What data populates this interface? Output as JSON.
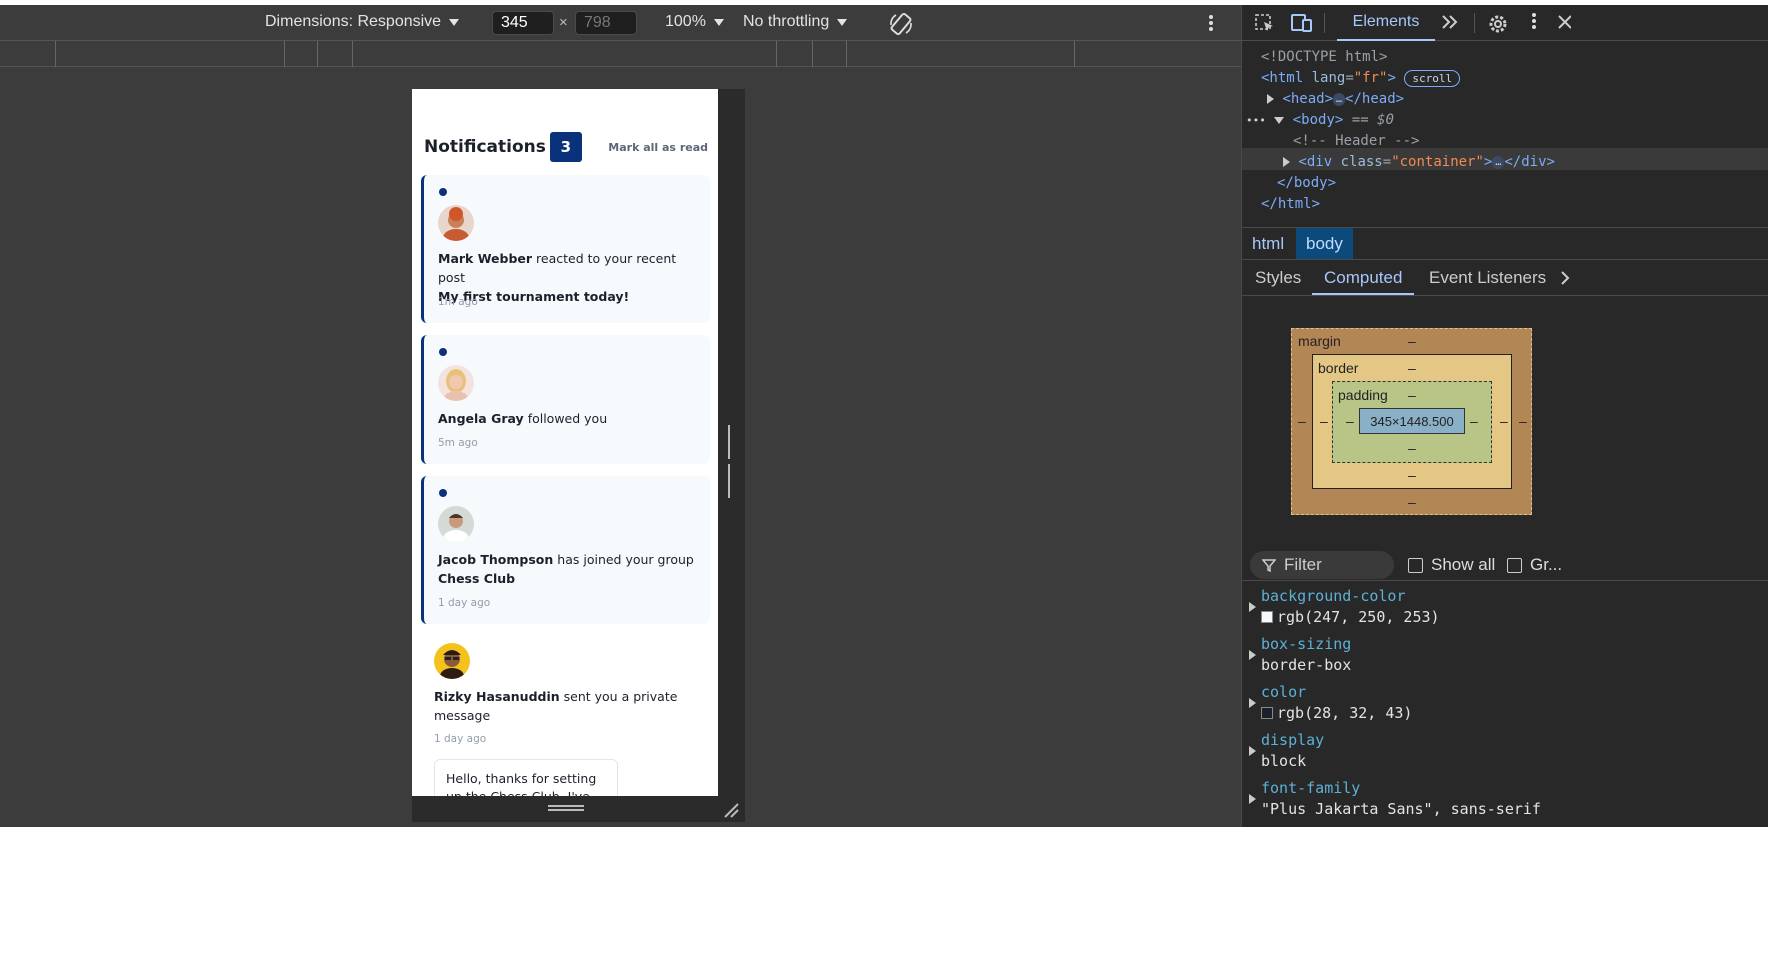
{
  "toolbar": {
    "dimensions_label": "Dimensions: Responsive",
    "width_value": "345",
    "times": "×",
    "height_placeholder": "798",
    "zoom": "100%",
    "throttling": "No throttling"
  },
  "app": {
    "title": "Notifications",
    "count": "3",
    "mark_all": "Mark all as read",
    "notifications": [
      {
        "user": "Mark Webber",
        "action": "reacted to your recent post",
        "target": "My first tournament today!",
        "time": "1m ago"
      },
      {
        "user": "Angela Gray",
        "action": "followed you",
        "target": "",
        "time": "5m ago"
      },
      {
        "user": "Jacob Thompson",
        "action": "has joined your group",
        "target": "Chess Club",
        "time": "1 day ago"
      },
      {
        "user": "Rizky Hasanuddin",
        "action": "sent you a private message",
        "target": "",
        "time": "1 day ago",
        "message": "Hello, thanks for setting up the Chess Club. I've been a"
      }
    ]
  },
  "devtools": {
    "tab_elements": "Elements",
    "dom": {
      "doctype": "<!DOCTYPE html>",
      "html_open": "<html",
      "lang_attr": "lang",
      "lang_value": "\"fr\"",
      "html_close_bracket": ">",
      "scroll_badge": "scroll",
      "head_open": "<head>",
      "head_close": "</head>",
      "body_open": "<body>",
      "body_eq": "== $0",
      "comment": "<!-- Header -->",
      "div_open": "<div",
      "class_attr": "class",
      "class_value": "\"container\"",
      "div_close": "</div>",
      "body_close": "</body>",
      "html_close": "</html>",
      "ellipsis": "…",
      "row_dots": "•••"
    },
    "breadcrumbs": [
      "html",
      "body"
    ],
    "subtabs": [
      "Styles",
      "Computed",
      "Event Listeners"
    ],
    "box_model": {
      "margin_label": "margin",
      "border_label": "border",
      "padding_label": "padding",
      "content_size": "345×1448.500",
      "dash": "–"
    },
    "filter_placeholder": "Filter",
    "show_all": "Show all",
    "group": "Gr...",
    "properties": [
      {
        "name": "background-color",
        "value": "rgb(247, 250, 253)",
        "swatch": "#f7fafd"
      },
      {
        "name": "box-sizing",
        "value": "border-box",
        "swatch": ""
      },
      {
        "name": "color",
        "value": "rgb(28, 32, 43)",
        "swatch": "#1c202b"
      },
      {
        "name": "display",
        "value": "block",
        "swatch": ""
      },
      {
        "name": "font-family",
        "value": "\"Plus Jakarta Sans\", sans-serif",
        "swatch": ""
      }
    ]
  },
  "colors": {
    "accent_blue": "#0a327b",
    "card_bg": "#f7fafd",
    "devtools_bg": "#282828",
    "viewport_bg": "#3c3c3c"
  }
}
